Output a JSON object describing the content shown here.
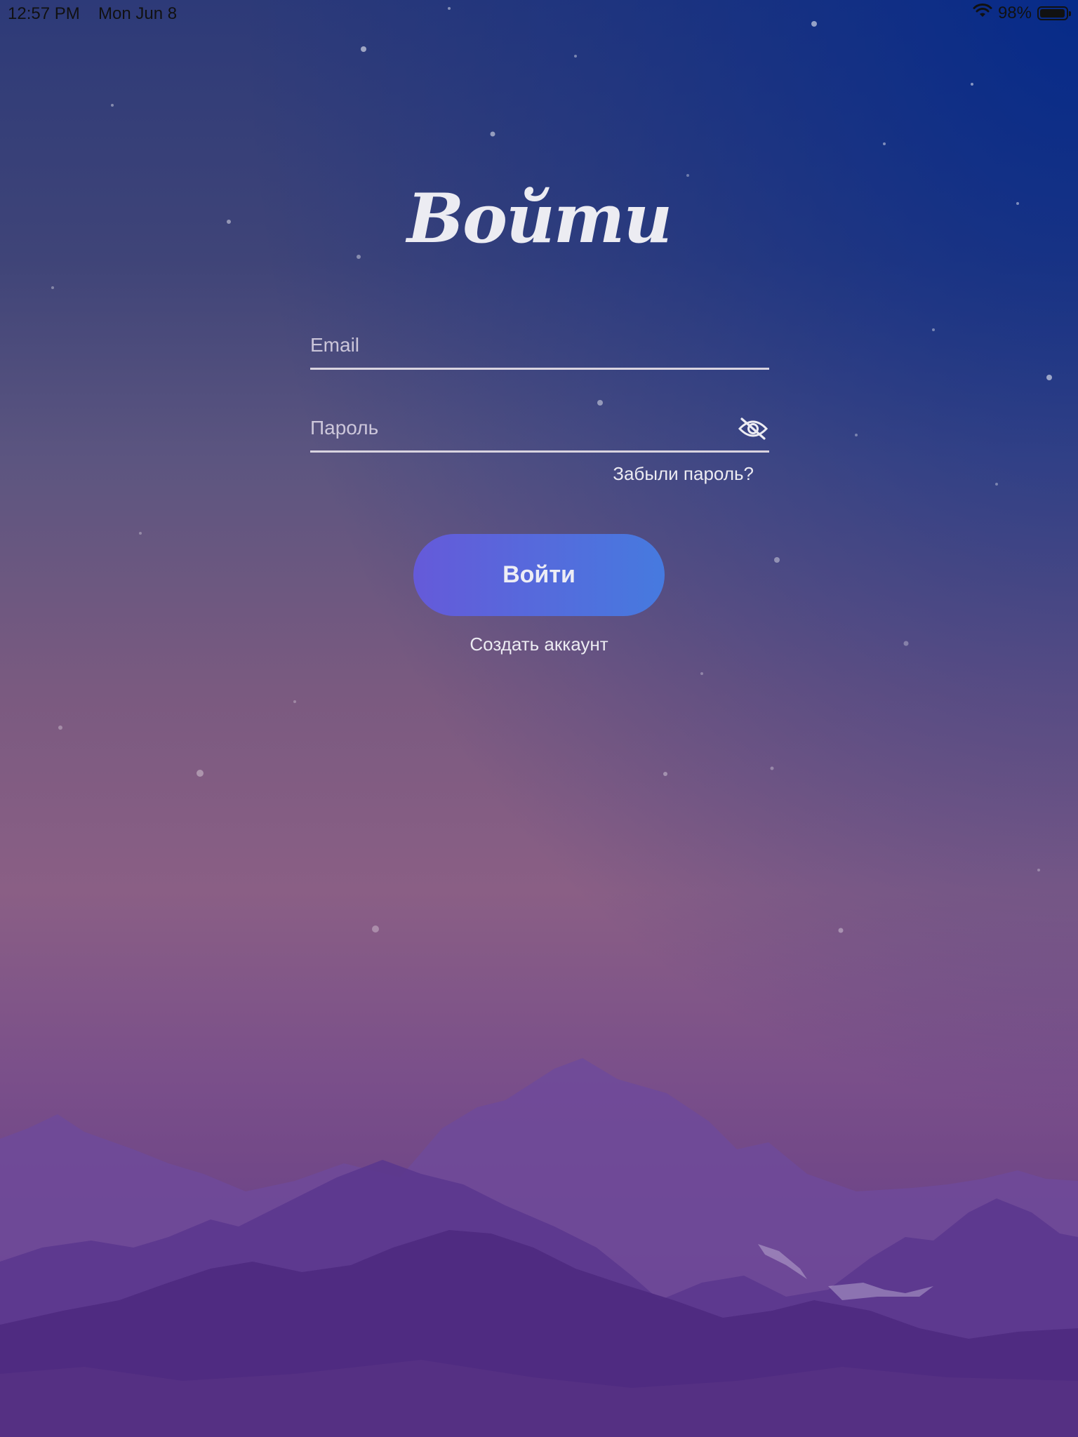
{
  "status_bar": {
    "time": "12:57 PM",
    "date": "Mon Jun 8",
    "battery_percent": "98%",
    "battery_level": 0.98,
    "icons": [
      "wifi-icon",
      "battery-icon"
    ]
  },
  "login": {
    "title": "Войти",
    "email": {
      "placeholder": "Email",
      "value": ""
    },
    "password": {
      "placeholder": "Пароль",
      "value": "",
      "toggle_icon": "eye-slash-icon"
    },
    "forgot_password": "Забыли пароль?",
    "submit_label": "Войти",
    "create_account": "Создать аккаунт"
  },
  "colors": {
    "button_gradient_start": "#655ad9",
    "button_gradient_end": "#467adf",
    "text": "#ecebf2",
    "underline": "#d9d4e0"
  }
}
